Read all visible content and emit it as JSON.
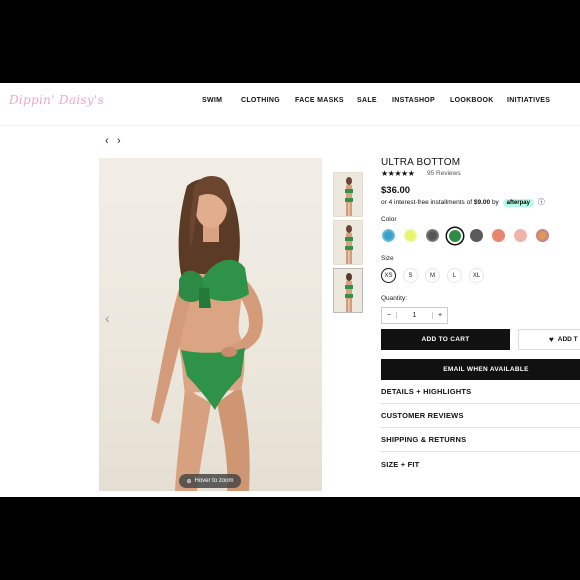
{
  "brand": {
    "logo_text": "Dippin' Daisy's"
  },
  "nav": {
    "items": [
      "SWIM",
      "CLOTHING",
      "FACE MASKS",
      "SALE",
      "INSTASHOP",
      "LOOKBOOK",
      "INITIATIVES"
    ]
  },
  "pager": {
    "prev": "‹",
    "next": "›"
  },
  "gallery": {
    "prev_arrow": "‹",
    "zoom_label": "Hover to zoom",
    "thumbnail_count": 3
  },
  "product": {
    "title": "ULTRA BOTTOM",
    "stars": "★★★★★",
    "reviews": "95 Reviews",
    "price": "$36.00",
    "installments_prefix": "or 4 interest-free installments of ",
    "installment_amount": "$9.00",
    "installments_by": " by ",
    "afterpay_label": "afterpay",
    "info_icon": "ⓘ",
    "color_label": "Color",
    "colors": [
      "#3aa0c8",
      "#e8f56a",
      "#555555",
      "#2e8b45",
      "#5a5a5a",
      "#e8856e",
      "#f0b3aa",
      "#d99a5a"
    ],
    "size_label": "Size",
    "sizes": [
      "XS",
      "S",
      "M",
      "L",
      "XL"
    ],
    "selected_size": "XS",
    "quantity_label": "Quantity:",
    "quantity_value": "1",
    "qty_minus": "−",
    "qty_plus": "+",
    "add_to_cart": "ADD TO CART",
    "add_to_wishlist": "ADD T",
    "email_when_available": "EMAIL WHEN AVAILABLE",
    "accordions": [
      "DETAILS + HIGHLIGHTS",
      "CUSTOMER REVIEWS",
      "SHIPPING & RETURNS",
      "SIZE + FIT"
    ]
  }
}
